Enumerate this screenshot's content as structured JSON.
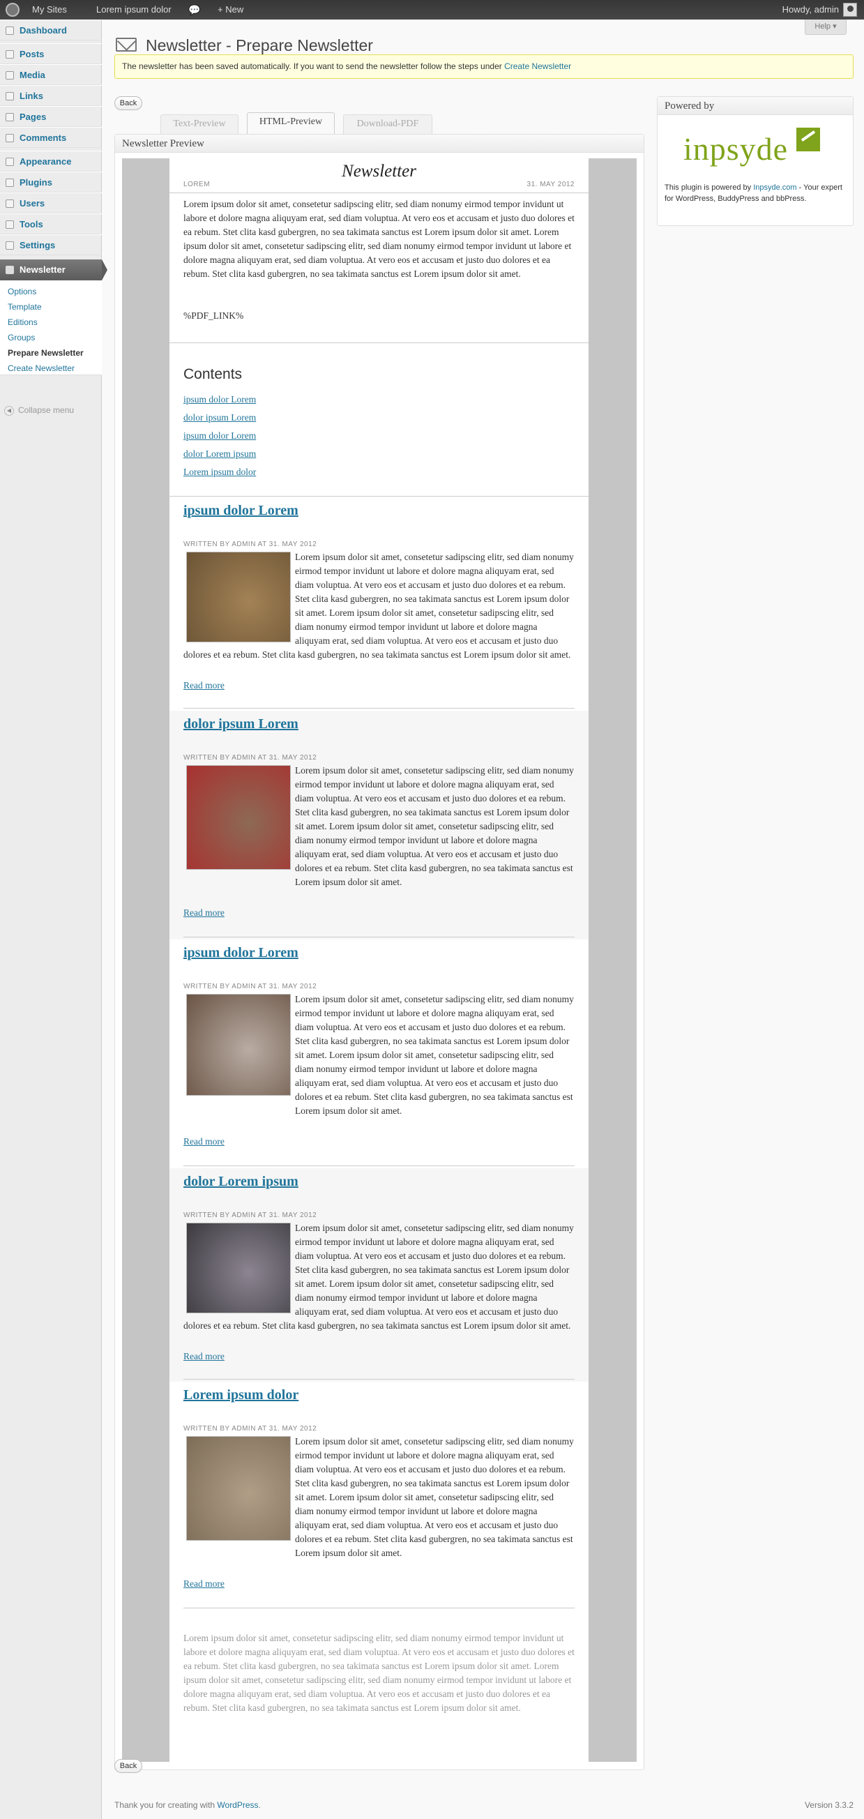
{
  "adminbar": {
    "my_sites": "My Sites",
    "site_name": "Lorem ipsum dolor",
    "new": "+ New",
    "greeting": "Howdy, admin"
  },
  "menu": {
    "items": [
      {
        "label": "Dashboard",
        "icon": "dashboard-icon"
      },
      {
        "label": "Posts",
        "icon": "pin-icon"
      },
      {
        "label": "Media",
        "icon": "media-icon"
      },
      {
        "label": "Links",
        "icon": "link-icon"
      },
      {
        "label": "Pages",
        "icon": "page-icon"
      },
      {
        "label": "Comments",
        "icon": "comment-icon"
      },
      {
        "label": "Appearance",
        "icon": "appearance-icon"
      },
      {
        "label": "Plugins",
        "icon": "plugin-icon"
      },
      {
        "label": "Users",
        "icon": "users-icon"
      },
      {
        "label": "Tools",
        "icon": "tools-icon"
      },
      {
        "label": "Settings",
        "icon": "settings-icon"
      },
      {
        "label": "Newsletter",
        "icon": "mail-icon"
      }
    ],
    "submenu": [
      "Options",
      "Template",
      "Editions",
      "Groups",
      "Prepare Newsletter",
      "Create Newsletter"
    ],
    "collapse": "Collapse menu"
  },
  "help": "Help ▾",
  "page_title": "Newsletter - Prepare Newsletter",
  "notice": {
    "text": "The newsletter has been saved automatically. If you want to send the newsletter follow the steps under ",
    "link": "Create Newsletter"
  },
  "back": "Back",
  "tabs": [
    "Text-Preview",
    "HTML-Preview",
    "Download-PDF"
  ],
  "preview_title": "Newsletter Preview",
  "newsletter": {
    "title": "Newsletter",
    "lorem": "LOREM",
    "date": "31. MAY 2012",
    "intro": "Lorem ipsum dolor sit amet, consetetur sadipscing elitr, sed diam nonumy eirmod tempor invidunt ut labore et dolore magna aliquyam erat, sed diam voluptua. At vero eos et accusam et justo duo dolores et ea rebum. Stet clita kasd gubergren, no sea takimata sanctus est Lorem ipsum dolor sit amet. Lorem ipsum dolor sit amet, consetetur sadipscing elitr, sed diam nonumy eirmod tempor invidunt ut labore et dolore magna aliquyam erat, sed diam voluptua. At vero eos et accusam et justo duo dolores et ea rebum. Stet clita kasd gubergren, no sea takimata sanctus est Lorem ipsum dolor sit amet.",
    "pdf_link": "%PDF_LINK%",
    "contents_heading": "Contents",
    "toc": [
      "ipsum dolor Lorem",
      "dolor ipsum Lorem",
      "ipsum dolor Lorem",
      "dolor Lorem ipsum",
      "Lorem ipsum dolor"
    ],
    "meta": "WRITTEN BY ADMIN AT 31. MAY 2012",
    "read_more": "Read more",
    "body": "Lorem ipsum dolor sit amet, consetetur sadipscing elitr, sed diam nonumy eirmod tempor invidunt ut labore et dolore magna aliquyam erat, sed diam voluptua. At vero eos et accusam et justo duo dolores et ea rebum. Stet clita kasd gubergren, no sea takimata sanctus est Lorem ipsum dolor sit amet. Lorem ipsum dolor sit amet, consetetur sadipscing elitr, sed diam nonumy eirmod tempor invidunt ut labore et dolore magna aliquyam erat, sed diam voluptua. At vero eos et accusam et justo duo dolores et ea rebum. Stet clita kasd gubergren, no sea takimata sanctus est Lorem ipsum dolor sit amet.",
    "articles": [
      {
        "title": "ipsum dolor Lorem",
        "image": "cat-blurry-photo",
        "colors": [
          "#6b5436",
          "#a38255"
        ]
      },
      {
        "title": "dolor ipsum Lorem",
        "image": "kitten-with-toy-photo",
        "colors": [
          "#a8302f",
          "#8d6a55"
        ]
      },
      {
        "title": "ipsum dolor Lorem",
        "image": "kitten-closeup-photo",
        "colors": [
          "#6a5445",
          "#b9aca3"
        ]
      },
      {
        "title": "dolor Lorem ipsum",
        "image": "kitten-lying-photo",
        "colors": [
          "#3c3a3f",
          "#8c8592"
        ]
      },
      {
        "title": "Lorem ipsum dolor",
        "image": "cat-paw-photo",
        "colors": [
          "#7d6c57",
          "#b09e87"
        ]
      }
    ],
    "footer": "Lorem ipsum dolor sit amet, consetetur sadipscing elitr, sed diam nonumy eirmod tempor invidunt ut labore et dolore magna aliquyam erat, sed diam voluptua. At vero eos et accusam et justo duo dolores et ea rebum. Stet clita kasd gubergren, no sea takimata sanctus est Lorem ipsum dolor sit amet. Lorem ipsum dolor sit amet, consetetur sadipscing elitr, sed diam nonumy eirmod tempor invidunt ut labore et dolore magna aliquyam erat, sed diam voluptua. At vero eos et accusam et justo duo dolores et ea rebum. Stet clita kasd gubergren, no sea takimata sanctus est Lorem ipsum dolor sit amet."
  },
  "sidebar": {
    "title": "Powered by",
    "logo": "inpsyde",
    "text_before": "This plugin is powered by ",
    "link": "Inpsyde.com",
    "text_after": " - Your expert for WordPress, BuddyPress and bbPress."
  },
  "footer": {
    "text": "Thank you for creating with ",
    "link": "WordPress",
    "suffix": ".",
    "version": "Version 3.3.2"
  },
  "colors": {
    "link": "#21759b",
    "logo_green": "#7fa31a",
    "notice_bg": "#ffffe0"
  }
}
